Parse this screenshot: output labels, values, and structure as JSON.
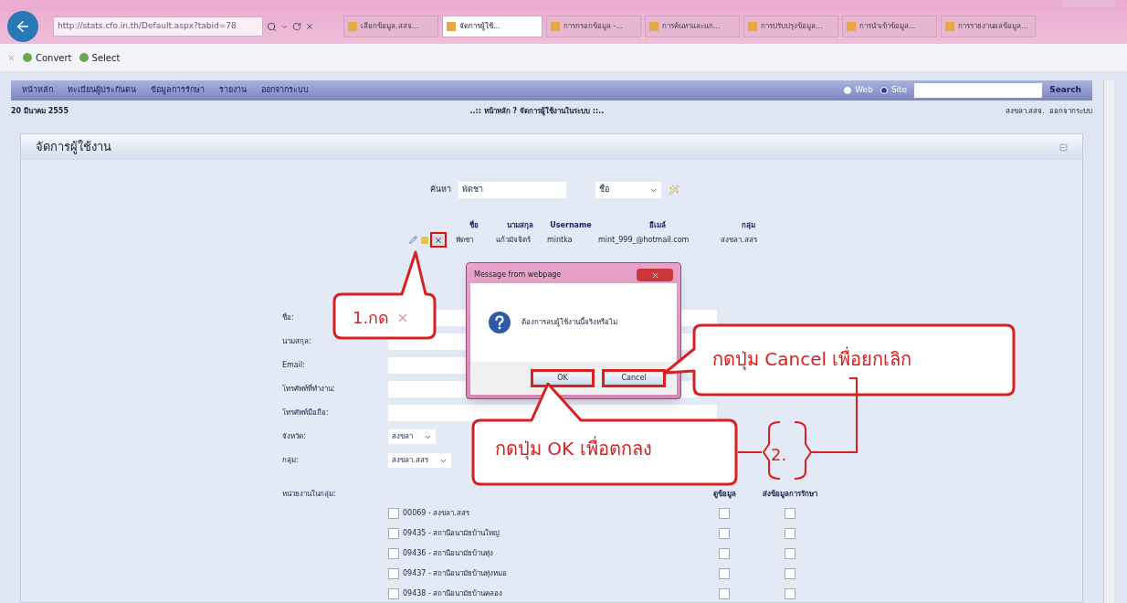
{
  "browser": {
    "url": "http://stats.cfo.in.th/Default.aspx?tabid=78",
    "tabs": [
      {
        "label": "เลือกข้อมูล.สสจ...",
        "selected": false
      },
      {
        "label": "จัดการผู้ใช้...",
        "selected": true
      },
      {
        "label": "การกรอกข้อมูล -...",
        "selected": false
      },
      {
        "label": "การค้นหาและแก...",
        "selected": false
      },
      {
        "label": "การปรับปรุงข้อมูล...",
        "selected": false
      },
      {
        "label": "การนำเข้าข้อมูล...",
        "selected": false
      },
      {
        "label": "การรายงานผลข้อมูล...",
        "selected": false
      }
    ],
    "toolbar": [
      "Convert",
      "Select"
    ]
  },
  "menu": {
    "items": [
      "หน้าหลัก",
      "ทะเบียนผู้ประกันตน",
      "ข้อมูลการรักษา",
      "รายงาน",
      "ออกจากระบบ"
    ],
    "search_scope": [
      {
        "label": "Web",
        "selected": false
      },
      {
        "label": "Site",
        "selected": true
      }
    ],
    "search_button": "Search"
  },
  "header": {
    "date": "20 มีนาคม 2555",
    "breadcrumb": "..:: หน้าหลัก ? จัดการผู้ใช้งานในระบบ ::..",
    "user": "สงขลา.สสจ.  ออกจากระบบ"
  },
  "panel": {
    "title": "จัดการผู้ใช้งาน",
    "search": {
      "label": "ค้นหา",
      "value": "พัดชา",
      "field": "ชื่อ"
    },
    "results": {
      "columns": [
        "ชื่อ",
        "นามสกุล",
        "Username",
        "อีเมล์",
        "กลุ่ม"
      ],
      "rows": [
        {
          "cells": [
            "พัดชา",
            "แก้วมัจจิตร์",
            "mintka",
            "mint_999_@hotmail.com",
            "สงขลา.สสร"
          ],
          "delete_highlighted": true
        }
      ]
    },
    "form": {
      "fields": [
        {
          "kind": "text",
          "label": "ชื่อ:"
        },
        {
          "kind": "text",
          "label": "นามสกุล:"
        },
        {
          "kind": "text",
          "label": "Email:"
        },
        {
          "kind": "text",
          "label": "โทรศัพท์ที่ทำงาน:"
        },
        {
          "kind": "text",
          "label": "โทรศัพท์มือถือ:"
        },
        {
          "kind": "select",
          "label": "จังหวัด:",
          "value": "สงขลา"
        },
        {
          "kind": "select",
          "label": "กลุ่ม:",
          "value": "สงขลา.สสร"
        }
      ],
      "units_label": "หน่วยงานในกลุ่ม:",
      "unit_columns": [
        "ดูข้อมูล",
        "ส่งข้อมูลการรักษา"
      ],
      "units": [
        {
          "label": "00069 - สงขลา.สสร",
          "checked": false,
          "view": false,
          "send": false
        },
        {
          "label": "09435 - สถานีอนามัยบ้านใหญ่",
          "checked": false,
          "view": false,
          "send": false
        },
        {
          "label": "09436 - สถานีอนามัยบ้านทุ่ง",
          "checked": false,
          "view": false,
          "send": false
        },
        {
          "label": "09437 - สถานีอนามัยบ้านทุ่งหมอ",
          "checked": false,
          "view": false,
          "send": false
        },
        {
          "label": "09438 - สถานีอนามัยบ้านคลอง",
          "checked": false,
          "view": false,
          "send": false
        }
      ]
    }
  },
  "dialog": {
    "title": "Message from webpage",
    "message": "ต้องการลบผู้ใช้งานนี้จริงหรือไม่",
    "buttons": [
      "OK",
      "Cancel"
    ]
  },
  "callouts": {
    "step1": "1.กด",
    "step1_symbol": "×",
    "cancel": "กดปุ่ม Cancel เพื่อยกเลิก",
    "ok": "กดปุ่ม OK เพื่อตกลง",
    "step2": "2."
  }
}
